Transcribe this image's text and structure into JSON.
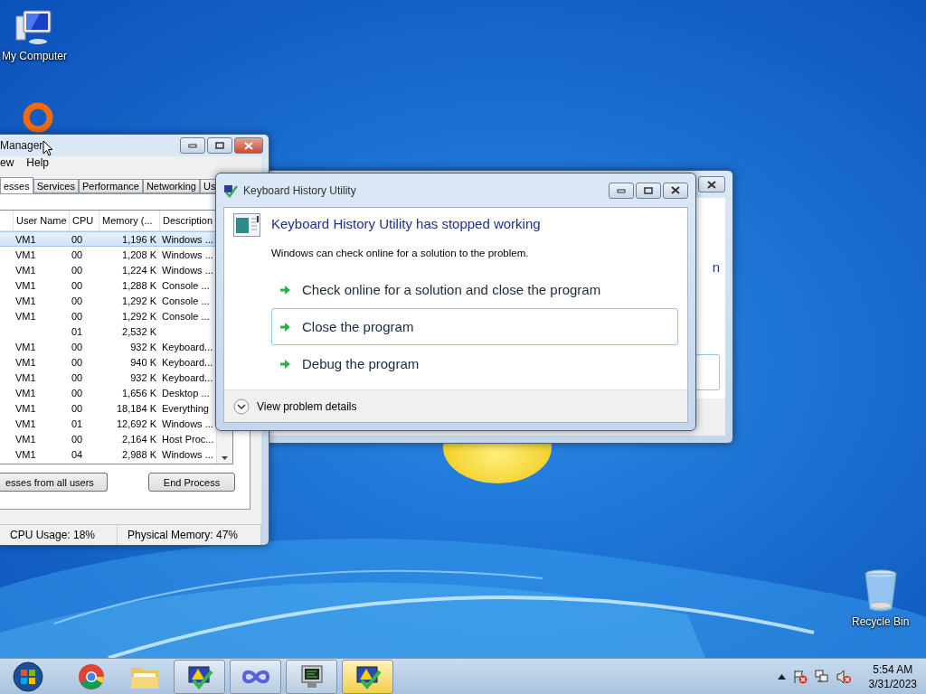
{
  "desktop_icons": [
    {
      "kind": "computer",
      "label": "My Computer"
    },
    {
      "kind": "ring"
    },
    {
      "kind": "bin",
      "label": "Recycle Bin"
    }
  ],
  "task_manager": {
    "title": "Manager",
    "menu": [
      "ew",
      "Help"
    ],
    "tabs": [
      {
        "label": "esses",
        "selected": true
      },
      {
        "label": "Services",
        "selected": false
      },
      {
        "label": "Performance",
        "selected": false
      },
      {
        "label": "Networking",
        "selected": false
      },
      {
        "label": "Us",
        "selected": false
      }
    ],
    "columns": [
      "User Name",
      "CPU",
      "Memory (...",
      "Description"
    ],
    "rows": [
      {
        "user": "VM1",
        "cpu": "00",
        "memory": "1,196 K",
        "description": "Windows ...",
        "selected": true
      },
      {
        "user": "VM1",
        "cpu": "00",
        "memory": "1,208 K",
        "description": "Windows ...",
        "selected": false
      },
      {
        "user": "VM1",
        "cpu": "00",
        "memory": "1,224 K",
        "description": "Windows ...",
        "selected": false
      },
      {
        "user": "VM1",
        "cpu": "00",
        "memory": "1,288 K",
        "description": "Console ...",
        "selected": false
      },
      {
        "user": "VM1",
        "cpu": "00",
        "memory": "1,292 K",
        "description": "Console ...",
        "selected": false
      },
      {
        "user": "VM1",
        "cpu": "00",
        "memory": "1,292 K",
        "description": "Console ...",
        "selected": false
      },
      {
        "cpu": "01",
        "memory": "2,532 K",
        "selected": false
      },
      {
        "user": "VM1",
        "cpu": "00",
        "memory": "932 K",
        "description": "Keyboard...",
        "selected": false
      },
      {
        "user": "VM1",
        "cpu": "00",
        "memory": "940 K",
        "description": "Keyboard...",
        "selected": false
      },
      {
        "user": "VM1",
        "cpu": "00",
        "memory": "932 K",
        "description": "Keyboard...",
        "selected": false
      },
      {
        "user": "VM1",
        "cpu": "00",
        "memory": "1,656 K",
        "description": "Desktop ...",
        "selected": false
      },
      {
        "user": "VM1",
        "cpu": "00",
        "memory": "18,184 K",
        "description": "Everything",
        "selected": false
      },
      {
        "user": "VM1",
        "cpu": "01",
        "memory": "12,692 K",
        "description": "Windows ...",
        "selected": false
      },
      {
        "user": "VM1",
        "cpu": "00",
        "memory": "2,164 K",
        "description": "Host Proc...",
        "selected": false
      },
      {
        "user": "VM1",
        "cpu": "04",
        "memory": "2,988 K",
        "description": "Windows ...",
        "selected": false
      }
    ],
    "buttons": [
      "esses from all users",
      "End Process"
    ],
    "status": [
      "CPU Usage: 18%",
      "Physical Memory: 47%"
    ]
  },
  "background_dialog": {
    "text": "n"
  },
  "error_dialog": {
    "title": "Keyboard History Utility",
    "heading": "Keyboard History Utility has stopped working",
    "message": "Windows can check online for a solution to the problem.",
    "options": [
      {
        "label": "Check online for a solution and close the program",
        "selected": false
      },
      {
        "label": "Close the program",
        "selected": true
      },
      {
        "label": "Debug the program",
        "selected": false
      }
    ],
    "details": "View problem details"
  },
  "taskbar": {
    "items": [
      {
        "kind": "start",
        "active": false
      },
      {
        "kind": "chrome",
        "active": false
      },
      {
        "kind": "folder",
        "active": false
      },
      {
        "kind": "warning-app",
        "active": false
      },
      {
        "kind": "infinity",
        "active": false
      },
      {
        "kind": "monitor",
        "active": false
      },
      {
        "kind": "warning-app",
        "active": true
      }
    ],
    "tray": [
      {
        "kind": "arrow"
      },
      {
        "kind": "flag"
      },
      {
        "kind": "network"
      },
      {
        "kind": "speaker"
      }
    ],
    "time": "5:54 AM",
    "date": "3/31/2023"
  }
}
